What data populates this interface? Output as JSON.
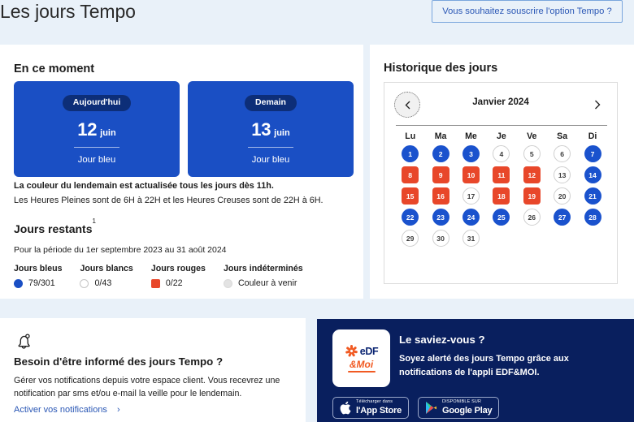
{
  "header": {
    "title": "Les jours Tempo",
    "subscribe_label": "Vous souhaitez souscrire l'option Tempo ?"
  },
  "current": {
    "section_title": "En ce moment",
    "cards": [
      {
        "pill": "Aujourd'hui",
        "day": "12",
        "month": "juin",
        "label": "Jour bleu"
      },
      {
        "pill": "Demain",
        "day": "13",
        "month": "juin",
        "label": "Jour bleu"
      }
    ],
    "info_line1": "La couleur du lendemain est actualisée tous les jours dès 11h.",
    "info_line2": "Les Heures Pleines sont de 6H à 22H et les Heures Creuses sont de 22H à 6H."
  },
  "remaining": {
    "title": "Jours restants",
    "footnote": "1",
    "period": "Pour la période du 1er septembre 2023 au 31 août 2024",
    "legend": [
      {
        "label": "Jours bleus",
        "value": "79/301",
        "style": "blue"
      },
      {
        "label": "Jours blancs",
        "value": "0/43",
        "style": "white"
      },
      {
        "label": "Jours rouges",
        "value": "0/22",
        "style": "red"
      },
      {
        "label": "Jours indéterminés",
        "value": "Couleur à venir",
        "style": "undef"
      }
    ]
  },
  "calendar": {
    "section_title": "Historique des jours",
    "month_label": "Janvier 2024",
    "prev_icon": "chevron-left",
    "next_icon": "chevron-right",
    "weekdays": [
      "Lu",
      "Ma",
      "Me",
      "Je",
      "Ve",
      "Sa",
      "Di"
    ],
    "weeks": [
      [
        {
          "n": "1",
          "c": "blue"
        },
        {
          "n": "2",
          "c": "blue"
        },
        {
          "n": "3",
          "c": "blue"
        },
        {
          "n": "4",
          "c": "white"
        },
        {
          "n": "5",
          "c": "white"
        },
        {
          "n": "6",
          "c": "white"
        },
        {
          "n": "7",
          "c": "blue"
        }
      ],
      [
        {
          "n": "8",
          "c": "red"
        },
        {
          "n": "9",
          "c": "red"
        },
        {
          "n": "10",
          "c": "red"
        },
        {
          "n": "11",
          "c": "red"
        },
        {
          "n": "12",
          "c": "red"
        },
        {
          "n": "13",
          "c": "white"
        },
        {
          "n": "14",
          "c": "blue"
        }
      ],
      [
        {
          "n": "15",
          "c": "red"
        },
        {
          "n": "16",
          "c": "red"
        },
        {
          "n": "17",
          "c": "white"
        },
        {
          "n": "18",
          "c": "red"
        },
        {
          "n": "19",
          "c": "red"
        },
        {
          "n": "20",
          "c": "white"
        },
        {
          "n": "21",
          "c": "blue"
        }
      ],
      [
        {
          "n": "22",
          "c": "blue"
        },
        {
          "n": "23",
          "c": "blue"
        },
        {
          "n": "24",
          "c": "blue"
        },
        {
          "n": "25",
          "c": "blue"
        },
        {
          "n": "26",
          "c": "white"
        },
        {
          "n": "27",
          "c": "blue"
        },
        {
          "n": "28",
          "c": "blue"
        }
      ],
      [
        {
          "n": "29",
          "c": "white"
        },
        {
          "n": "30",
          "c": "white"
        },
        {
          "n": "31",
          "c": "white"
        },
        {
          "n": "",
          "c": "empty"
        },
        {
          "n": "",
          "c": "empty"
        },
        {
          "n": "",
          "c": "empty"
        },
        {
          "n": "",
          "c": "empty"
        }
      ]
    ]
  },
  "notifications": {
    "icon": "bell-icon",
    "title": "Besoin d'être informé des jours Tempo ?",
    "text": "Gérer vos notifications depuis votre espace client. Vous recevrez une notification par sms et/ou e-mail la veille pour le lendemain.",
    "link_label": "Activer vos notifications",
    "link_chevron": "›"
  },
  "promo": {
    "logo_brand": "eDF",
    "logo_sub": "&Moi",
    "heading": "Le saviez-vous ?",
    "body": "Soyez alerté des jours Tempo grâce aux notifications de l'appli EDF&MOI.",
    "stores": [
      {
        "small": "Télécharger dans",
        "big": "l'App Store",
        "icon": "apple-icon"
      },
      {
        "small": "DISPONIBLE SUR",
        "big": "Google Play",
        "icon": "google-play-icon"
      }
    ]
  },
  "colors": {
    "page_bg": "#e9f1f9",
    "blue": "#1a4fc4",
    "dark_blue": "#0d2e78",
    "promo_bg": "#091f5e",
    "red": "#e8472a",
    "link": "#2a57b5",
    "orange": "#f15a22"
  }
}
